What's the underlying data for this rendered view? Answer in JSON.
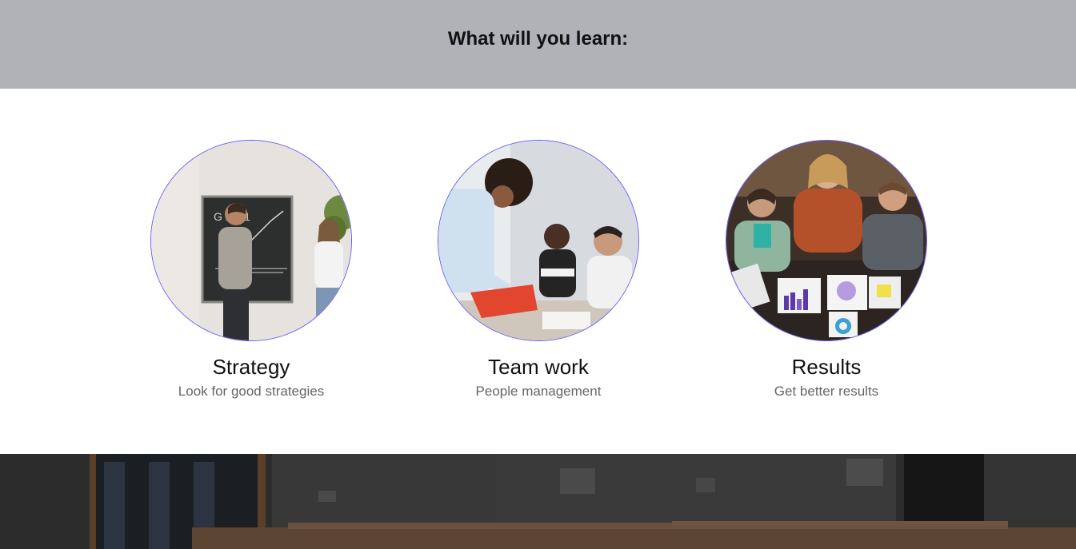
{
  "header": {
    "title": "What will you learn:"
  },
  "cards": [
    {
      "title": "Strategy",
      "subtitle": "Look for good strategies",
      "image": "presentation-at-blackboard-photo"
    },
    {
      "title": "Team work",
      "subtitle": "People management",
      "image": "team-collaborating-photo"
    },
    {
      "title": "Results",
      "subtitle": "Get better results",
      "image": "team-reviewing-charts-photo"
    }
  ],
  "bottom_section": {
    "image": "lecture-hall-photo"
  },
  "colors": {
    "header_bg": "#b1b2b7",
    "circle_border": "#6b5cf5",
    "title_text": "#111111",
    "subtitle_text": "#666666"
  }
}
